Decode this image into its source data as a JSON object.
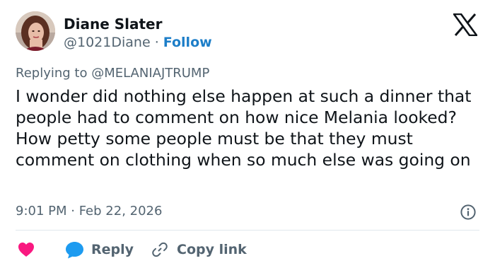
{
  "author": {
    "name": "Diane Slater",
    "handle": "@1021Diane",
    "separator": "·",
    "follow_label": "Follow"
  },
  "replying_to": "Replying to @MELANIAJTRUMP",
  "tweet_text": "I wonder did nothing else happen at such a dinner that people had to comment on how nice Melania looked? How petty some people must be that they must comment on clothing when so much else was going on",
  "timestamp": "9:01 PM · Feb 22, 2026",
  "actions": {
    "reply_label": "Reply",
    "copy_link_label": "Copy link"
  },
  "icons": {
    "logo": "x-logo-icon",
    "info": "info-icon",
    "like": "heart-icon",
    "reply": "speech-bubble-icon",
    "copy": "link-icon"
  },
  "colors": {
    "follow": "#1d7ec8",
    "like": "#f91880",
    "reply": "#1d9bf0",
    "muted": "#536471",
    "text": "#0f1419"
  }
}
